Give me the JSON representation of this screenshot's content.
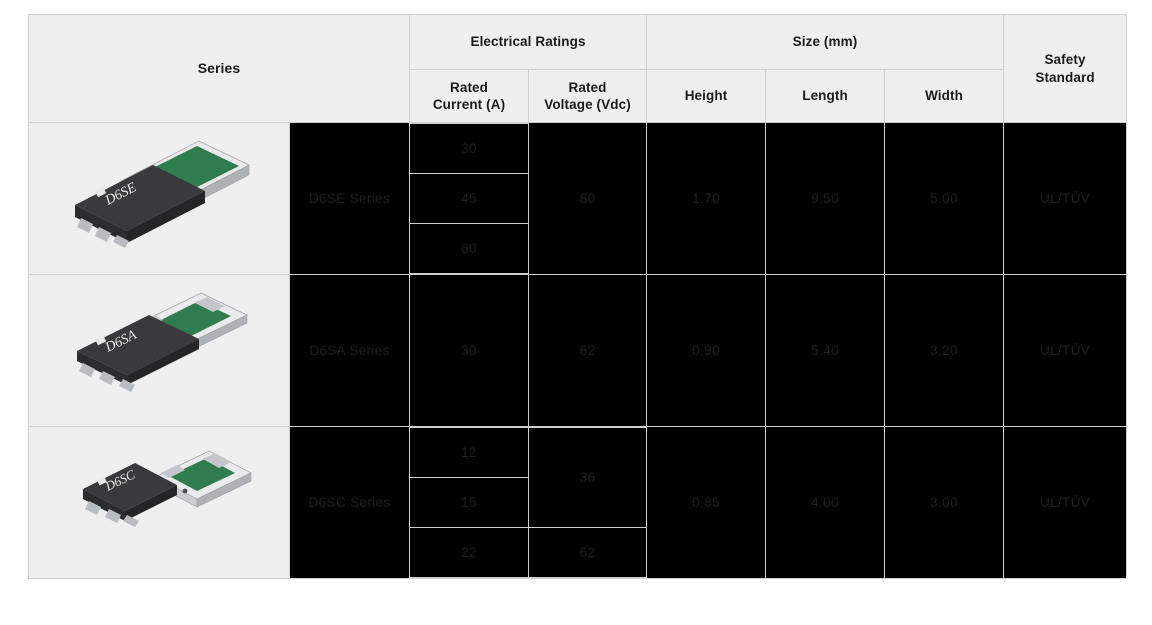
{
  "table": {
    "headers": {
      "series": "Series",
      "electrical_ratings": "Electrical Ratings",
      "rated_current": "Rated\nCurrent (A)",
      "rated_current_line1": "Rated",
      "rated_current_line2": "Current (A)",
      "rated_voltage_line1": "Rated",
      "rated_voltage_line2": "Voltage (Vdc)",
      "size": "Size (mm)",
      "height": "Height",
      "length": "Length",
      "width": "Width",
      "safety_standard_line1": "Safety",
      "safety_standard_line2": "Standard"
    },
    "rows": [
      {
        "series": "D6SE Series",
        "image_label": "D6SE",
        "rated_current": [
          "30",
          "45",
          "60"
        ],
        "rated_voltage": [
          "80"
        ],
        "height": "1.70",
        "length": "9.50",
        "width": "5.00",
        "safety_standard": "UL/TÜV"
      },
      {
        "series": "D6SA Series",
        "image_label": "D6SA",
        "rated_current": [
          "30"
        ],
        "rated_voltage": [
          "62"
        ],
        "height": "0.90",
        "length": "5.40",
        "width": "3.20",
        "safety_standard": "UL/TÜV"
      },
      {
        "series": "D6SC Series",
        "image_label": "D6SC",
        "rated_current": [
          "12",
          "15",
          "22"
        ],
        "rated_voltage": [
          "36",
          "62"
        ],
        "height": "0.85",
        "length": "4.00",
        "width": "3.00",
        "safety_standard": "UL/TÜV"
      }
    ]
  },
  "colors": {
    "header_bg": "#efefef",
    "cell_bg": "#efefef",
    "data_bg": "#000000",
    "border": "#d0d0d0",
    "header_text": "#1b1b1b",
    "data_text": "#1f1f1f",
    "chip_body": "#3a3a3c",
    "chip_pad": "#b9bcc0",
    "chip_green": "#2f7d4f"
  }
}
